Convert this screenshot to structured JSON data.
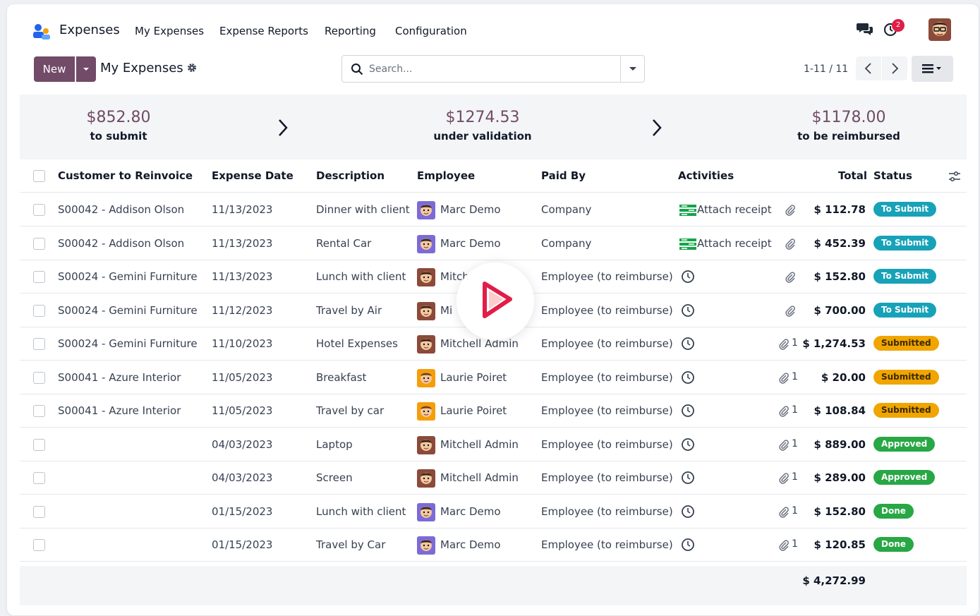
{
  "navbar": {
    "app_name": "Expenses",
    "menus": [
      "My Expenses",
      "Expense Reports",
      "Reporting",
      "Configuration"
    ],
    "notification_count": "2"
  },
  "control": {
    "new_label": "New",
    "breadcrumb": "My Expenses",
    "search_placeholder": "Search...",
    "pager": "1-11 / 11"
  },
  "summary": [
    {
      "amount": "$852.80",
      "label": "to submit"
    },
    {
      "amount": "$1274.53",
      "label": "under validation"
    },
    {
      "amount": "$1178.00",
      "label": "to be reimbursed"
    }
  ],
  "columns": {
    "customer": "Customer to Reinvoice",
    "date": "Expense Date",
    "description": "Description",
    "employee": "Employee",
    "paid_by": "Paid By",
    "activities": "Activities",
    "total": "Total",
    "status": "Status"
  },
  "rows": [
    {
      "customer": "S00042 - Addison Olson",
      "date": "11/13/2023",
      "description": "Dinner with client",
      "employee": "Marc Demo",
      "paid_by": "Company",
      "activity": "Attach receipt",
      "attachments": "",
      "total": "$ 112.78",
      "status": "To Submit"
    },
    {
      "customer": "S00042 - Addison Olson",
      "date": "11/13/2023",
      "description": "Rental Car",
      "employee": "Marc Demo",
      "paid_by": "Company",
      "activity": "Attach receipt",
      "attachments": "",
      "total": "$ 452.39",
      "status": "To Submit"
    },
    {
      "customer": "S00024 - Gemini Furniture",
      "date": "11/13/2023",
      "description": "Lunch with client",
      "employee": "Mitch",
      "paid_by": "Employee (to reimburse)",
      "activity": "",
      "attachments": "",
      "total": "$ 152.80",
      "status": "To Submit"
    },
    {
      "customer": "S00024 - Gemini Furniture",
      "date": "11/12/2023",
      "description": "Travel by Air",
      "employee": "Mi",
      "paid_by": "Employee (to reimburse)",
      "activity": "",
      "attachments": "",
      "total": "$ 700.00",
      "status": "To Submit"
    },
    {
      "customer": "S00024 - Gemini Furniture",
      "date": "11/10/2023",
      "description": "Hotel Expenses",
      "employee": "Mitchell Admin",
      "paid_by": "Employee (to reimburse)",
      "activity": "",
      "attachments": "1",
      "total": "$ 1,274.53",
      "status": "Submitted"
    },
    {
      "customer": "S00041 - Azure Interior",
      "date": "11/05/2023",
      "description": "Breakfast",
      "employee": "Laurie Poiret",
      "paid_by": "Employee (to reimburse)",
      "activity": "",
      "attachments": "1",
      "total": "$ 20.00",
      "status": "Submitted"
    },
    {
      "customer": "S00041 - Azure Interior",
      "date": "11/05/2023",
      "description": "Travel by car",
      "employee": "Laurie Poiret",
      "paid_by": "Employee (to reimburse)",
      "activity": "",
      "attachments": "1",
      "total": "$ 108.84",
      "status": "Submitted"
    },
    {
      "customer": "",
      "date": "04/03/2023",
      "description": "Laptop",
      "employee": "Mitchell Admin",
      "paid_by": "Employee (to reimburse)",
      "activity": "",
      "attachments": "1",
      "total": "$ 889.00",
      "status": "Approved"
    },
    {
      "customer": "",
      "date": "04/03/2023",
      "description": "Screen",
      "employee": "Mitchell Admin",
      "paid_by": "Employee (to reimburse)",
      "activity": "",
      "attachments": "1",
      "total": "$ 289.00",
      "status": "Approved"
    },
    {
      "customer": "",
      "date": "01/15/2023",
      "description": "Lunch with client",
      "employee": "Marc Demo",
      "paid_by": "Employee (to reimburse)",
      "activity": "",
      "attachments": "1",
      "total": "$ 152.80",
      "status": "Done"
    },
    {
      "customer": "",
      "date": "01/15/2023",
      "description": "Travel by Car",
      "employee": "Marc Demo",
      "paid_by": "Employee (to reimburse)",
      "activity": "",
      "attachments": "1",
      "total": "$ 120.85",
      "status": "Done"
    }
  ],
  "grand_total": "$ 4,272.99",
  "colors": {
    "brand": "#714b67",
    "to_submit": "#17a2b8",
    "submitted": "#f0a500",
    "approved": "#28a745",
    "done": "#28a745",
    "play": "#e11d48"
  }
}
